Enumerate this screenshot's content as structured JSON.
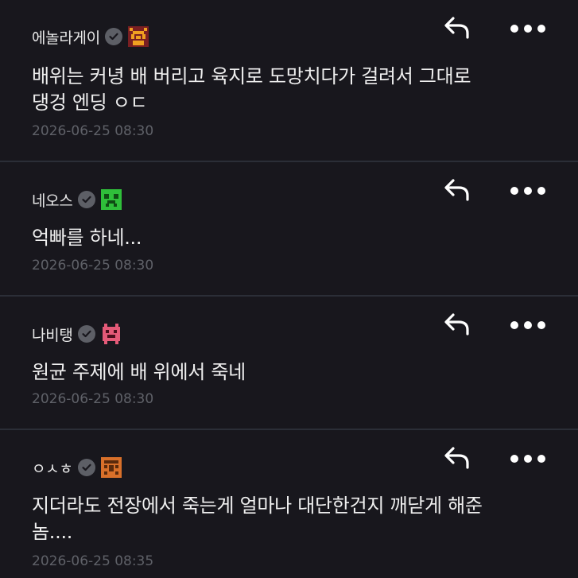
{
  "comments": [
    {
      "username": "에놀라게이",
      "text": "배위는 커녕 배 버리고 육지로 도망치다가 걸려서 그대로\n댕겅 엔딩 ㅇㄷ",
      "timestamp": "2026-06-25 08:30",
      "badge_icon": "pixel-creature-badge-orange",
      "badge_color": "#f0a020"
    },
    {
      "username": "네오스",
      "text": "억빠를 하네...",
      "timestamp": "2026-06-25 08:30",
      "badge_icon": "pixel-creature-badge-green",
      "badge_color": "#2fbf3a"
    },
    {
      "username": "나비탱",
      "text": "원균 주제에 배 위에서 죽네",
      "timestamp": "2026-06-25 08:30",
      "badge_icon": "pixel-creature-badge-pink",
      "badge_color": "#e45a78"
    },
    {
      "username": "ㅇㅅㅎ",
      "text": "지더라도 전장에서 죽는게 얼마나 대단한건지 깨닫게 해준\n놈....",
      "timestamp": "2026-06-25 08:35",
      "badge_icon": "pixel-creature-badge-brown",
      "badge_color": "#d8702a"
    }
  ],
  "colors": {
    "background": "#18171d",
    "divider": "#2b2e37",
    "timestamp": "#5f6168",
    "verified": "#5d5f66"
  },
  "icons": {
    "reply": "reply-arrow-icon",
    "more": "more-dots-icon",
    "verified": "verified-check-icon"
  }
}
